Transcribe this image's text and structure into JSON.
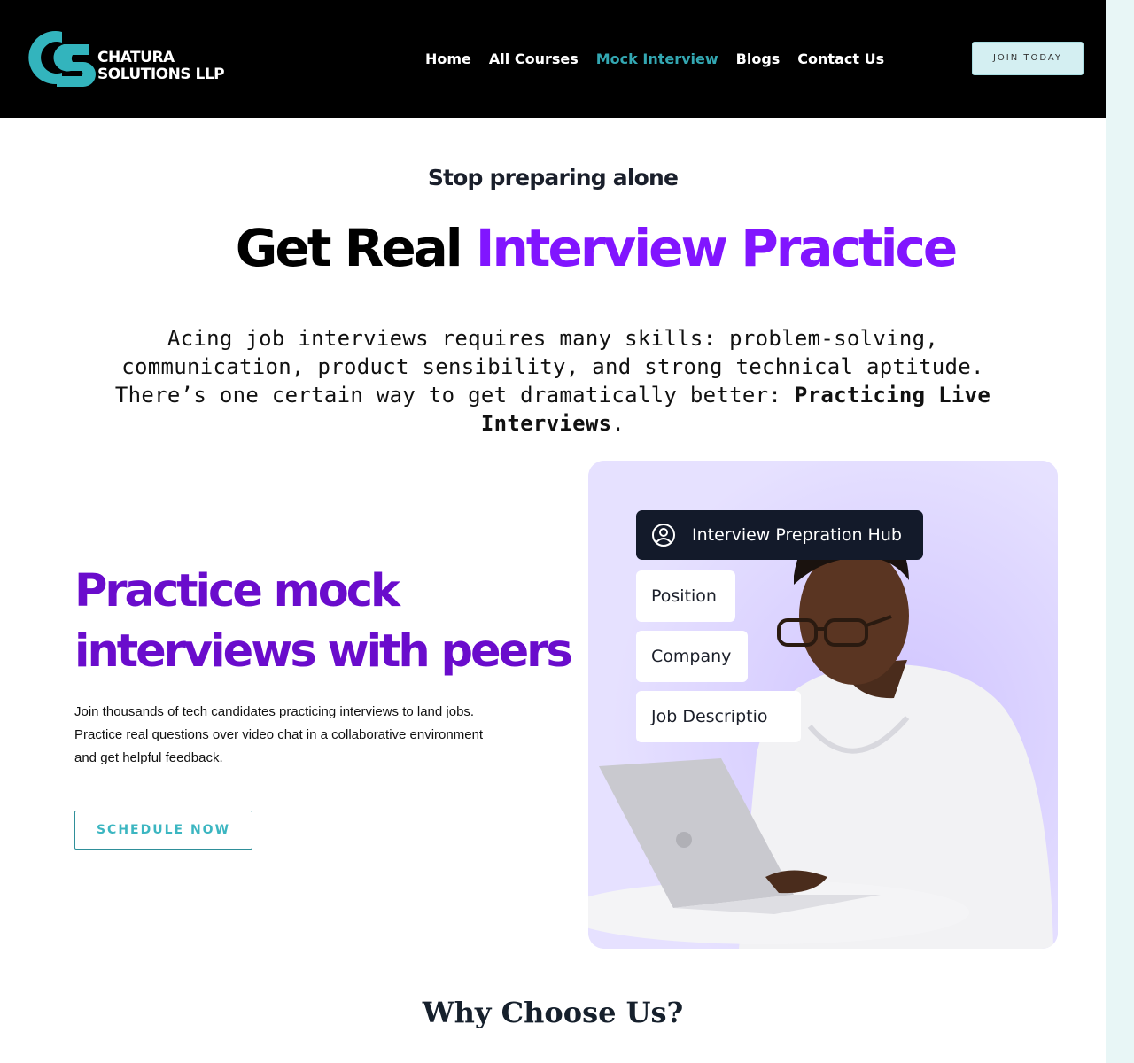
{
  "brand": {
    "name_line1": "CHATURA",
    "name_line2": "SOLUTIONS LLP",
    "colors": {
      "teal": "#33a7b2",
      "purple": "#8115ff",
      "dark_purple": "#6a0ccc"
    }
  },
  "nav": {
    "items": [
      {
        "label": "Home",
        "active": false
      },
      {
        "label": "All Courses",
        "active": false
      },
      {
        "label": "Mock Interview",
        "active": true
      },
      {
        "label": "Blogs",
        "active": false
      },
      {
        "label": "Contact Us",
        "active": false
      }
    ],
    "cta": "JOIN TODAY"
  },
  "hero": {
    "eyebrow": "Stop preparing alone",
    "title_plain": "Get Real",
    "title_accent": "Interview Practice",
    "intro": "Acing job interviews requires many skills: problem-solving, communication, product sensibility, and strong technical aptitude. There’s one certain way to get dramatically better:",
    "intro_bold": "Practicing Live Interviews",
    "intro_end": "."
  },
  "feature": {
    "title_line1": "Practice mock",
    "title_line2": "interviews with peers",
    "description_line1": "Join thousands of tech candidates practicing interviews to land jobs.",
    "description_line2": "Practice real questions over video chat in a collaborative environment",
    "description_line3": "and get helpful feedback.",
    "button": "SCHEDULE NOW",
    "image": {
      "hub_label": "Interview Prepration Hub",
      "hub_icon": "user-circle-icon",
      "chips": [
        "Position",
        "Company",
        "Job Descriptio"
      ]
    }
  },
  "why": {
    "title": "Why Choose Us?"
  }
}
